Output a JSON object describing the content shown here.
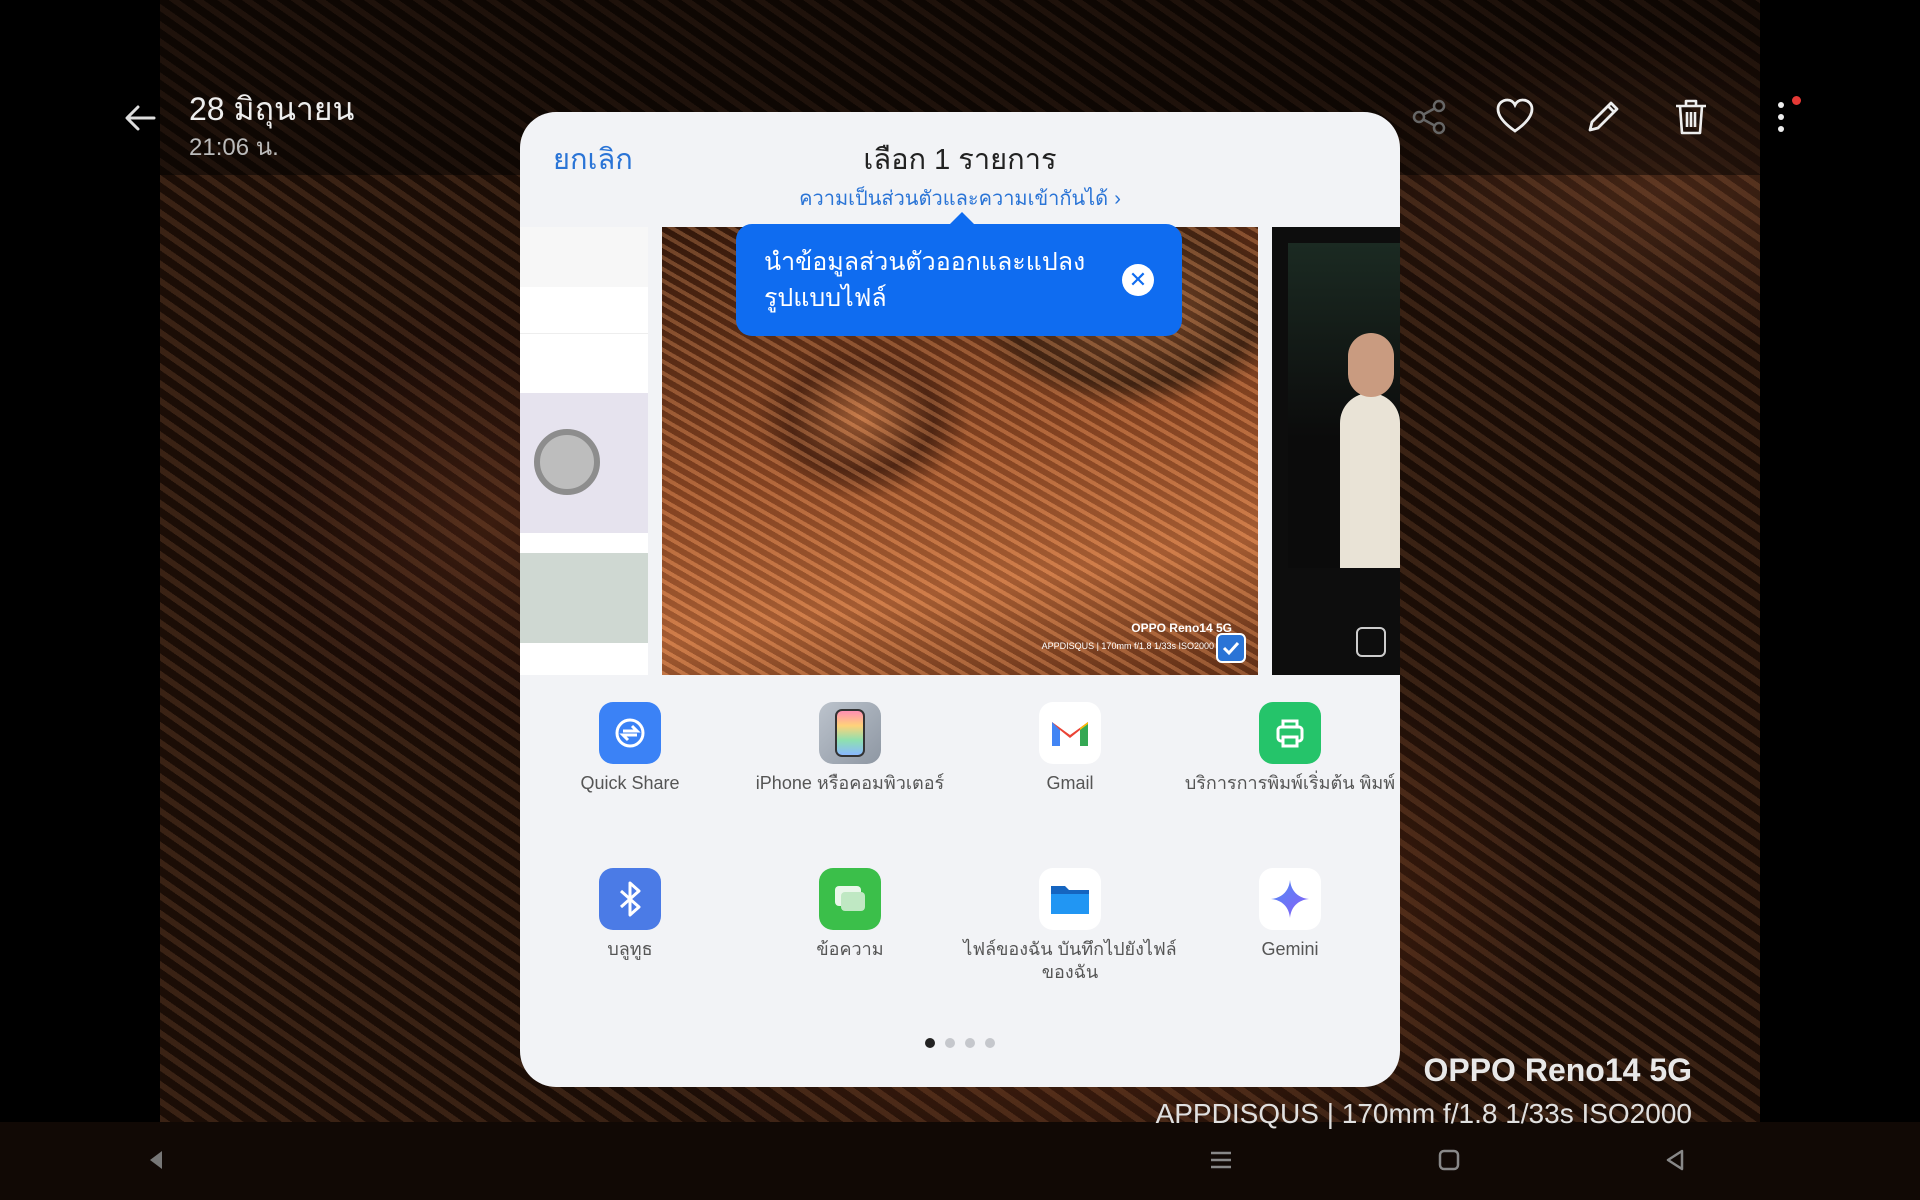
{
  "header": {
    "date": "28 มิถุนายน",
    "time": "21:06 น."
  },
  "toolbar": {
    "icons": [
      "share-icon",
      "heart-icon",
      "edit-icon",
      "trash-icon",
      "more-icon"
    ]
  },
  "watermark": {
    "brand": "OPPO Reno14 5G",
    "meta": "APPDISQUS | 170mm  f/1.8  1/33s  ISO2000"
  },
  "share_sheet": {
    "cancel_label": "ยกเลิก",
    "title": "เลือก 1 รายการ",
    "privacy_link": "ความเป็นส่วนตัวและความเข้ากันได้",
    "tooltip": "นำข้อมูลส่วนตัวออกและแปลงรูปแบบไฟล์",
    "thumb_brand": "OPPO Reno14 5G",
    "thumb_meta": "APPDISQUS | 170mm f/1.8 1/33s ISO2000",
    "apps": [
      {
        "label": "Quick Share"
      },
      {
        "label": "iPhone หรือคอมพิวเตอร์"
      },
      {
        "label": "Gmail"
      },
      {
        "label": "บริการการพิมพ์เริ่มต้น พิมพ์"
      },
      {
        "label": "บลูทูธ"
      },
      {
        "label": "ข้อความ"
      },
      {
        "label": "ไฟล์ของฉัน บันทึกไปยังไฟล์ของฉัน"
      },
      {
        "label": "Gemini"
      }
    ],
    "pages": 4,
    "active_page": 1
  },
  "colors": {
    "accent": "#2a74d6",
    "tooltip_bg": "#0f6cf0",
    "notification_dot": "#e53935"
  }
}
